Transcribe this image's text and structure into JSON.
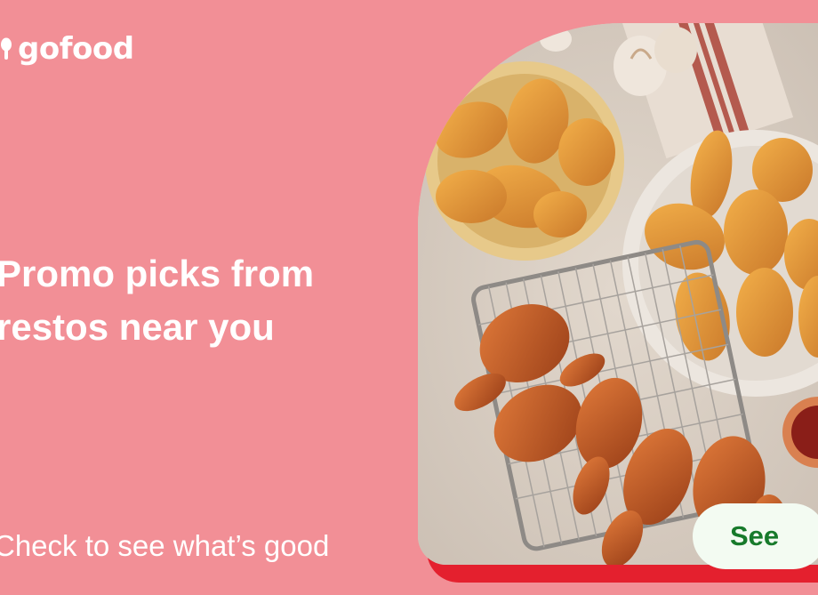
{
  "brand": {
    "name": "gofood",
    "logo_icon": "gofood-pin-icon"
  },
  "headline": {
    "line1": "Promo picks from",
    "line2": "restos near you"
  },
  "subline": "Check to see what’s good",
  "hero": {
    "image": "fried-chicken-platter-photo"
  },
  "cta": {
    "label": "See"
  },
  "colors": {
    "background": "#f28f96",
    "accent": "#e4202e",
    "button_bg": "#f3fbf2",
    "button_text": "#177a2b"
  }
}
